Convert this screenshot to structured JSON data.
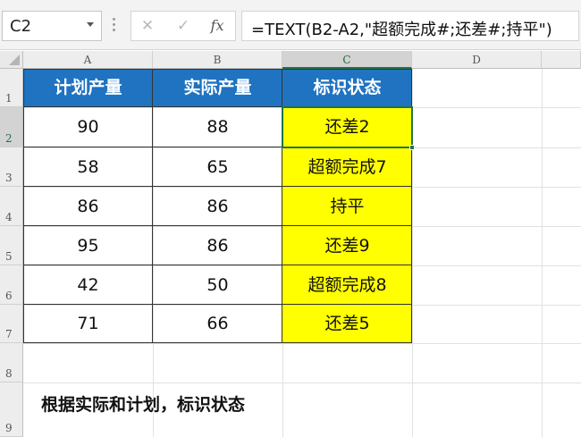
{
  "name_box": {
    "value": "C2"
  },
  "formula_bar": {
    "cancel_glyph": "✕",
    "enter_glyph": "✓",
    "fx_label": "fx",
    "formula": "=TEXT(B2-A2,\"超额完成#;还差#;持平\")"
  },
  "columns": [
    "A",
    "B",
    "C",
    "D"
  ],
  "rows": [
    "1",
    "2",
    "3",
    "4",
    "5",
    "6",
    "7",
    "8",
    "9"
  ],
  "table": {
    "headers": [
      "计划产量",
      "实际产量",
      "标识状态"
    ],
    "rows": [
      [
        "90",
        "88",
        "还差2"
      ],
      [
        "58",
        "65",
        "超额完成7"
      ],
      [
        "86",
        "86",
        "持平"
      ],
      [
        "95",
        "86",
        "还差9"
      ],
      [
        "42",
        "50",
        "超额完成8"
      ],
      [
        "71",
        "66",
        "还差5"
      ]
    ]
  },
  "note": "根据实际和计划，标识状态",
  "colors": {
    "header_fill": "#1f73c0",
    "status_fill": "#ffff00",
    "selection": "#217346"
  },
  "icons": {
    "name_box_dropdown": "chevron-down-icon",
    "cancel": "close-icon",
    "enter": "check-icon",
    "insert_function": "fx-icon"
  }
}
